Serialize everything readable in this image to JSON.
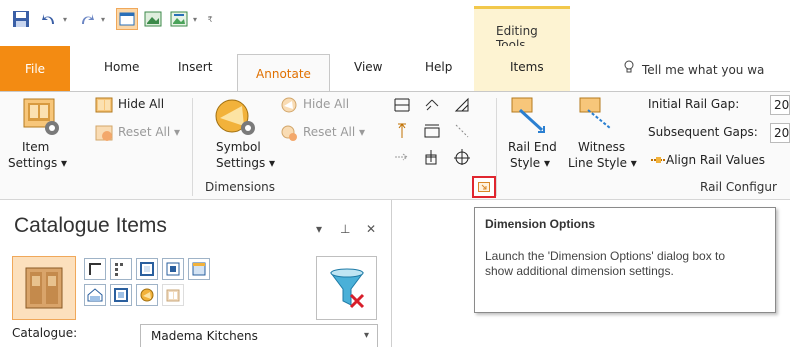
{
  "contextual": {
    "group_label": "Editing Tools"
  },
  "tabs": {
    "file": "File",
    "home": "Home",
    "insert": "Insert",
    "annotate": "Annotate",
    "view": "View",
    "help": "Help",
    "items": "Items",
    "tell_me": "Tell me what you wa"
  },
  "ribbon": {
    "item_settings": {
      "line1": "Item",
      "line2": "Settings"
    },
    "hide_all": "Hide All",
    "reset_all": "Reset All",
    "symbol_settings": {
      "line1": "Symbol",
      "line2": "Settings"
    },
    "hide_all_2": "Hide All",
    "reset_all_2": "Reset All",
    "dimensions_group": "Dimensions",
    "rail_end_style": {
      "line1": "Rail End",
      "line2": "Style"
    },
    "witness_line_style": {
      "line1": "Witness",
      "line2": "Line Style"
    },
    "initial_rail_gap_label": "Initial Rail Gap:",
    "initial_rail_gap_value": "20",
    "subsequent_gaps_label": "Subsequent Gaps:",
    "subsequent_gaps_value": "20",
    "align_rail_values": "Align Rail Values",
    "rail_config_group": "Rail Configur"
  },
  "panel": {
    "title": "Catalogue Items",
    "catalogue_label": "Catalogue:",
    "catalogue_value": "Madema Kitchens"
  },
  "tooltip": {
    "title": "Dimension Options",
    "body": "Launch the 'Dimension Options' dialog box to show additional dimension settings."
  },
  "colors": {
    "file_tab": "#f38b12",
    "annotate_tab_text": "#e07000",
    "contextual_bg": "#fdf3d2",
    "launcher_highlight": "#e0262f"
  }
}
